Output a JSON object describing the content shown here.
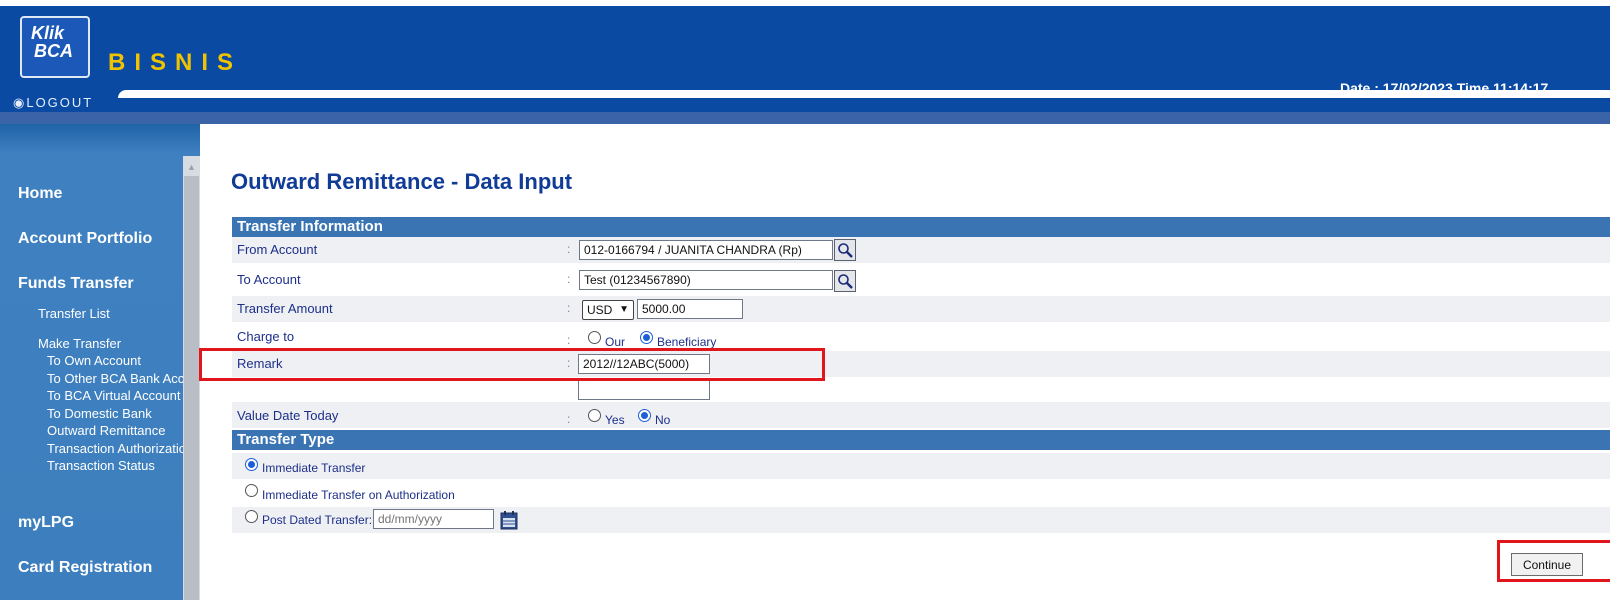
{
  "header": {
    "logo_line1": "Klik",
    "logo_line2": "BCA",
    "brand": "BISNIS",
    "datetime": "Date : 17/02/2023 Time 11:14:17",
    "logout": "LOGOUT"
  },
  "sidebar": {
    "home": "Home",
    "account_portfolio": "Account Portfolio",
    "funds_transfer": "Funds Transfer",
    "transfer_list": "Transfer List",
    "make_transfer": "Make Transfer",
    "to_own_account": "To Own Account",
    "to_other_bca": "To Other BCA Bank Account",
    "to_bca_virtual": "To BCA Virtual Account",
    "to_domestic_bank": "To Domestic Bank",
    "outward_remittance": "Outward Remittance",
    "transaction_authorization": "Transaction Authorization",
    "transaction_status": "Transaction Status",
    "mylpg": "myLPG",
    "card_registration": "Card Registration"
  },
  "main": {
    "title": "Outward Remittance - Data Input",
    "transfer_info": {
      "heading": "Transfer Information",
      "from_account_label": "From Account",
      "from_account_value": "012-0166794 / JUANITA CHANDRA (Rp)",
      "to_account_label": "To Account",
      "to_account_value": "Test (01234567890)",
      "amount_label": "Transfer Amount",
      "currency": "USD",
      "amount": "5000.00",
      "charge_label": "Charge to",
      "charge_option_our": "Our",
      "charge_option_beneficiary": "Beneficiary",
      "charge_selected": "Beneficiary",
      "remark_label": "Remark",
      "remark_value": "2012//12ABC(5000)",
      "remark_value2": "",
      "value_date_label": "Value Date Today",
      "value_date_yes": "Yes",
      "value_date_no": "No",
      "value_date_selected": "No",
      "separator": ":"
    },
    "transfer_type": {
      "heading": "Transfer Type",
      "immediate": "Immediate Transfer",
      "immediate_on_auth": "Immediate Transfer on Authorization",
      "post_dated": "Post Dated Transfer:",
      "date_placeholder": "dd/mm/yyyy",
      "selected": "Immediate Transfer"
    },
    "continue_label": "Continue"
  },
  "colors": {
    "header_blue": "#0a4aa3",
    "brand_yellow": "#f0c300",
    "section_blue": "#3a74b3",
    "highlight_red": "#e0161c"
  }
}
